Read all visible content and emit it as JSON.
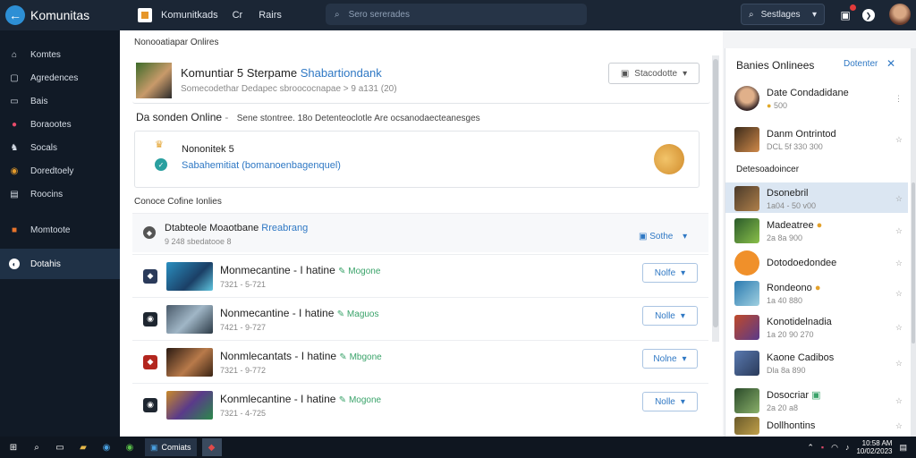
{
  "topbar": {
    "app_title": "Komunitas",
    "brand": "Komunitkads",
    "tab1": "Cr",
    "tab2": "Rairs",
    "search_placeholder": "Sero sererades",
    "dropdown": "Sestlages"
  },
  "sidebar": {
    "items": [
      {
        "label": "Komtes",
        "icon": "home-icon"
      },
      {
        "label": "Agredences",
        "icon": "square-icon"
      },
      {
        "label": "Bais",
        "icon": "folder-icon"
      },
      {
        "label": "Boraootes",
        "icon": "heart-icon"
      },
      {
        "label": "Socals",
        "icon": "person-icon"
      },
      {
        "label": "Doredtoely",
        "icon": "gamepad-icon"
      },
      {
        "label": "Roocins",
        "icon": "grid-icon"
      },
      {
        "label": "Momtoote",
        "icon": "app-icon"
      },
      {
        "label": "Dotahis",
        "icon": "discord-icon"
      }
    ]
  },
  "main": {
    "heading": "Nonooatiapar Onlires",
    "profile": {
      "name": "Komuntiar 5 Sterpame",
      "name_link": "Shabartiondank",
      "sub": "Somecodethar Dedapec sbroococnapae > 9 a131 (20)",
      "dropdown": "Stacodotte"
    },
    "online_line": {
      "title": "Da sonden Online",
      "sep": "-",
      "desc": "Sene stontree. 18o Detenteoclotle Are ocsanodaecteanesges"
    },
    "notice": {
      "title": "Nononitek 5",
      "link": "Sabahemitiat (bomanoenbagenquel)"
    },
    "list_title": "Conoce Cofine Ionlies",
    "list_header": {
      "text": "Dtabteole Moaotbane",
      "link": "Rreabrang",
      "meta": "9 248 sbedatooe 8",
      "action": "Sothe"
    },
    "rows": [
      {
        "title": "Monmecantine - I hatine",
        "tag": "Mogone",
        "meta": "7321 - 5-721",
        "btn": "Nolfe"
      },
      {
        "title": "Nonmecantine - I hatine",
        "tag": "Maguos",
        "meta": "7421 - 9-727",
        "btn": "Nolle"
      },
      {
        "title": "Nonmlecantats - I hatine",
        "tag": "Mbgone",
        "meta": "7321 - 9-772",
        "btn": "Nolne"
      },
      {
        "title": "Konmlecantine - I hatine",
        "tag": "Mogone",
        "meta": "7321 - 4-725",
        "btn": "Nolle"
      }
    ]
  },
  "right": {
    "title": "Banies Onlinees",
    "link": "Dotenter",
    "friends_top": [
      {
        "name": "Date Condadidane",
        "status": "500"
      },
      {
        "name": "Danm Ontrintod",
        "status": "DCL 5f 330 300"
      }
    ],
    "section": "Detesoadoincer",
    "friends": [
      {
        "name": "Dsonebril",
        "status": "1a04 - 50 v00"
      },
      {
        "name": "Madeatree",
        "status": "2a 8a 900"
      },
      {
        "name": "Dotodoedondee",
        "status": ""
      },
      {
        "name": "Rondeono",
        "status": "1a 40 880"
      },
      {
        "name": "Konotidelnadia",
        "status": "1a 20 90 270"
      },
      {
        "name": "Kaone Cadibos",
        "status": "Dla 8a 890"
      },
      {
        "name": "Dosocriar",
        "status": "2a 20 a8"
      },
      {
        "name": "Dollhontins",
        "status": ""
      }
    ]
  },
  "taskbar": {
    "app_label": "Comiats",
    "time": "10:58 AM",
    "date": "10/02/2023"
  }
}
